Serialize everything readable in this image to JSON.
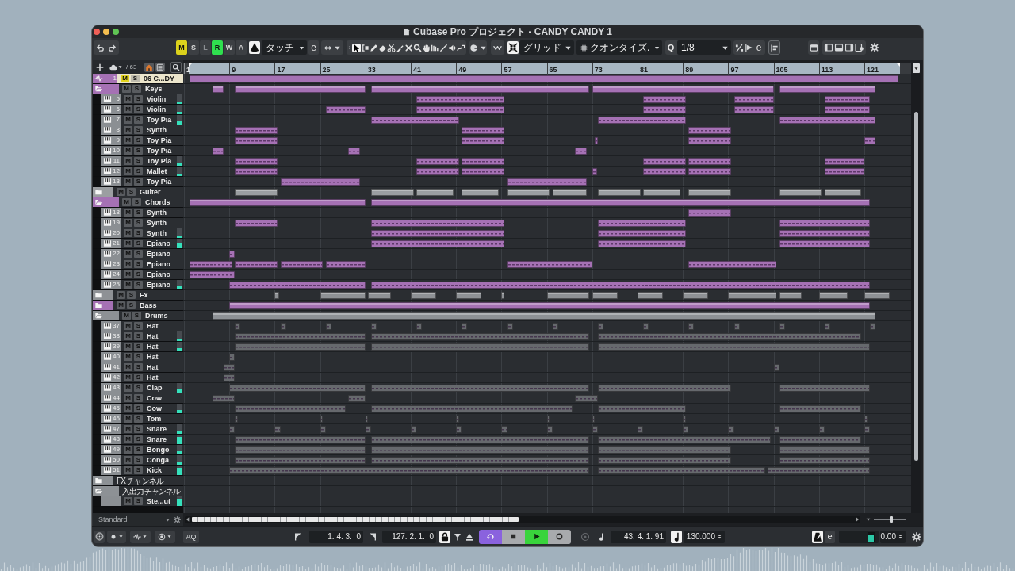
{
  "window": {
    "title": "Cubase Pro プロジェクト - CANDY CANDY 1"
  },
  "toolbar": {
    "indicators": [
      {
        "label": "M",
        "on": true,
        "disabled": false,
        "color": "#dcd21c"
      },
      {
        "label": "S",
        "on": false,
        "disabled": false
      },
      {
        "label": "L",
        "on": false,
        "disabled": true
      },
      {
        "label": "R",
        "on": true,
        "disabled": false,
        "color": "#2fe04f"
      },
      {
        "label": "W",
        "on": false,
        "disabled": false
      },
      {
        "label": "A",
        "on": false,
        "disabled": false
      }
    ],
    "automation_mode": {
      "value": "タッチ",
      "edit": "e"
    },
    "tools": [
      {
        "kind": "pointer",
        "selected": true
      },
      {
        "kind": "range",
        "selected": false
      },
      {
        "kind": "pencil",
        "selected": false
      },
      {
        "kind": "eraser",
        "selected": false
      },
      {
        "kind": "scissors",
        "selected": false
      },
      {
        "kind": "glue",
        "selected": false
      },
      {
        "kind": "cross",
        "selected": false
      },
      {
        "kind": "magnifier",
        "selected": false
      },
      {
        "kind": "hand",
        "selected": false
      },
      {
        "kind": "bars",
        "selected": false
      },
      {
        "kind": "line",
        "selected": false
      },
      {
        "kind": "speaker",
        "selected": false
      },
      {
        "kind": "warp",
        "selected": false
      }
    ],
    "snap": {
      "on": true,
      "value": "グリッド"
    },
    "grid_type": {
      "value": "クオンタイズ."
    },
    "quantize": {
      "label": "Q",
      "value": "1/8",
      "edit": "e"
    }
  },
  "track_list": {
    "count": "/ 63",
    "tracks": [
      {
        "kind": "audio",
        "number": "1",
        "name": "06 C...DY",
        "mute": "M",
        "solo": "S",
        "muted": true,
        "selected": true,
        "color": "#a571b4"
      },
      {
        "kind": "folder",
        "name": "Keys",
        "mute": "M",
        "solo": "S",
        "muted": false,
        "selected": false,
        "expanded": true,
        "color": "#a571b4",
        "children": [
          {
            "kind": "instrument",
            "number": "5",
            "name": "Violin",
            "mute": "M",
            "solo": "S",
            "muted": false,
            "selected": false,
            "color": "#a571b4",
            "level": 0.25
          },
          {
            "kind": "instrument",
            "number": "6",
            "name": "Violin",
            "mute": "M",
            "solo": "S",
            "muted": false,
            "selected": false,
            "color": "#a571b4",
            "level": 0.25
          },
          {
            "kind": "instrument",
            "number": "7",
            "name": "Toy Pia",
            "mute": "M",
            "solo": "S",
            "muted": false,
            "selected": false,
            "color": "#a571b4",
            "level": 0.33
          },
          {
            "kind": "instrument",
            "number": "8",
            "name": "Synth",
            "mute": "M",
            "solo": "S",
            "muted": false,
            "selected": false,
            "color": "#a571b4"
          },
          {
            "kind": "instrument",
            "number": "9",
            "name": "Toy Pia",
            "mute": "M",
            "solo": "S",
            "muted": false,
            "selected": false,
            "color": "#a571b4"
          },
          {
            "kind": "instrument",
            "number": "10",
            "name": "Toy Pia",
            "mute": "M",
            "solo": "S",
            "muted": false,
            "selected": false,
            "color": "#a571b4"
          },
          {
            "kind": "instrument",
            "number": "11",
            "name": "Toy Pia",
            "mute": "M",
            "solo": "S",
            "muted": false,
            "selected": false,
            "color": "#a571b4",
            "level": 0.25
          },
          {
            "kind": "instrument",
            "number": "12",
            "name": "Mallet",
            "mute": "M",
            "solo": "S",
            "muted": false,
            "selected": false,
            "color": "#a571b4",
            "level": 0.25
          },
          {
            "kind": "instrument",
            "number": "13",
            "name": "Toy Pia",
            "mute": "M",
            "solo": "S",
            "muted": false,
            "selected": false,
            "color": "#a571b4"
          }
        ]
      },
      {
        "kind": "folder",
        "name": "Guiter",
        "mute": "M",
        "solo": "S",
        "muted": false,
        "selected": false,
        "expanded": false,
        "color": "#9b9ea1"
      },
      {
        "kind": "folder",
        "name": "Chords",
        "mute": "M",
        "solo": "S",
        "muted": false,
        "selected": false,
        "expanded": true,
        "color": "#a571b4",
        "children": [
          {
            "kind": "instrument",
            "number": "18",
            "name": "Synth",
            "mute": "M",
            "solo": "S",
            "muted": false,
            "selected": false,
            "color": "#a571b4"
          },
          {
            "kind": "instrument",
            "number": "19",
            "name": "Synth",
            "mute": "M",
            "solo": "S",
            "muted": false,
            "selected": false,
            "color": "#a571b4"
          },
          {
            "kind": "instrument",
            "number": "20",
            "name": "Synth",
            "mute": "M",
            "solo": "S",
            "muted": false,
            "selected": false,
            "color": "#a571b4",
            "level": 0.25
          },
          {
            "kind": "instrument",
            "number": "21",
            "name": "Epiano",
            "mute": "M",
            "solo": "S",
            "muted": false,
            "selected": false,
            "color": "#a571b4",
            "level": 0.5
          },
          {
            "kind": "instrument",
            "number": "22",
            "name": "Epiano",
            "mute": "M",
            "solo": "S",
            "muted": false,
            "selected": false,
            "color": "#a571b4"
          },
          {
            "kind": "instrument",
            "number": "23",
            "name": "Epiano",
            "mute": "M",
            "solo": "S",
            "muted": false,
            "selected": false,
            "color": "#a571b4"
          },
          {
            "kind": "instrument",
            "number": "24",
            "name": "Epiano",
            "mute": "M",
            "solo": "S",
            "muted": false,
            "selected": false,
            "color": "#a571b4"
          },
          {
            "kind": "instrument",
            "number": "25",
            "name": "Epiano",
            "mute": "M",
            "solo": "S",
            "muted": false,
            "selected": false,
            "color": "#a571b4",
            "level": 0.33
          }
        ]
      },
      {
        "kind": "folder",
        "name": "Fx",
        "mute": "M",
        "solo": "S",
        "muted": false,
        "selected": false,
        "expanded": false,
        "color": "#8e9195"
      },
      {
        "kind": "folder",
        "name": "Bass",
        "mute": "M",
        "solo": "S",
        "muted": false,
        "selected": false,
        "expanded": false,
        "color": "#a571b4"
      },
      {
        "kind": "folder",
        "name": "Drums",
        "mute": "M",
        "solo": "S",
        "muted": false,
        "selected": false,
        "expanded": true,
        "color": "#8d9195",
        "children": [
          {
            "kind": "instrument",
            "number": "37",
            "name": "Hat",
            "mute": "M",
            "solo": "S",
            "muted": false,
            "selected": false,
            "color": "#66696d"
          },
          {
            "kind": "instrument",
            "number": "38",
            "name": "Hat",
            "mute": "M",
            "solo": "S",
            "muted": false,
            "selected": false,
            "color": "#66696d",
            "level": 0.25
          },
          {
            "kind": "instrument",
            "number": "39",
            "name": "Hat",
            "mute": "M",
            "solo": "S",
            "muted": false,
            "selected": false,
            "color": "#66696d",
            "level": 0.33
          },
          {
            "kind": "instrument",
            "number": "40",
            "name": "Hat",
            "mute": "M",
            "solo": "S",
            "muted": false,
            "selected": false,
            "color": "#66696d"
          },
          {
            "kind": "instrument",
            "number": "41",
            "name": "Hat",
            "mute": "M",
            "solo": "S",
            "muted": false,
            "selected": false,
            "color": "#66696d"
          },
          {
            "kind": "instrument",
            "number": "42",
            "name": "Hat",
            "mute": "M",
            "solo": "S",
            "muted": false,
            "selected": false,
            "color": "#66696d"
          },
          {
            "kind": "instrument",
            "number": "43",
            "name": "Clap",
            "mute": "M",
            "solo": "S",
            "muted": false,
            "selected": false,
            "color": "#66696d",
            "level": 0.33
          },
          {
            "kind": "instrument",
            "number": "44",
            "name": "Cow",
            "mute": "M",
            "solo": "S",
            "muted": false,
            "selected": false,
            "color": "#66696d"
          },
          {
            "kind": "instrument",
            "number": "45",
            "name": "Cow",
            "mute": "M",
            "solo": "S",
            "muted": false,
            "selected": false,
            "color": "#66696d",
            "level": 0.33
          },
          {
            "kind": "instrument",
            "number": "46",
            "name": "Tom",
            "mute": "M",
            "solo": "S",
            "muted": false,
            "selected": false,
            "color": "#66696d"
          },
          {
            "kind": "instrument",
            "number": "47",
            "name": "Snare",
            "mute": "M",
            "solo": "S",
            "muted": false,
            "selected": false,
            "color": "#66696d",
            "level": 0.25
          },
          {
            "kind": "instrument",
            "number": "48",
            "name": "Snare",
            "mute": "M",
            "solo": "S",
            "muted": false,
            "selected": false,
            "color": "#66696d",
            "level": 0.75
          },
          {
            "kind": "instrument",
            "number": "49",
            "name": "Bongo",
            "mute": "M",
            "solo": "S",
            "muted": false,
            "selected": false,
            "color": "#66696d",
            "level": 0.33
          },
          {
            "kind": "instrument",
            "number": "50",
            "name": "Conga",
            "mute": "M",
            "solo": "S",
            "muted": false,
            "selected": false,
            "color": "#66696d",
            "level": 0.25
          },
          {
            "kind": "instrument",
            "number": "51",
            "name": "Kick",
            "mute": "M",
            "solo": "S",
            "muted": false,
            "selected": false,
            "color": "#66696d",
            "level": 0.75
          }
        ]
      },
      {
        "kind": "folder",
        "name": "FX チャンネル",
        "selected": false,
        "expanded": false
      },
      {
        "kind": "folder",
        "name": "入出力チャンネル",
        "selected": false,
        "expanded": true,
        "children": [
          {
            "kind": "output",
            "name": "Ste...ut",
            "mute": "M",
            "solo": "S",
            "muted": false,
            "selected": false,
            "level": 0.75
          }
        ]
      }
    ]
  },
  "ruler": {
    "labels": [
      "1",
      "9",
      "17",
      "25",
      "33",
      "41",
      "49",
      "57",
      "65",
      "73",
      "81",
      "89",
      "97",
      "105",
      "113",
      "121"
    ]
  },
  "status_bar": {
    "preset": "Standard",
    "zoom": {
      "level": 0.55
    }
  },
  "transport": {
    "auto_quantize": "AQ",
    "left_locator": "1. 4. 3.  0",
    "right_locator": "127. 2. 1.  0",
    "buttons": [
      {
        "kind": "cycle",
        "on": true
      },
      {
        "kind": "stop",
        "on": false
      },
      {
        "kind": "play",
        "on": true
      },
      {
        "kind": "record",
        "on": false
      }
    ],
    "position": "43. 4. 1. 91",
    "tempo": "130.000",
    "click_edit": "e",
    "meter": {
      "level": 0.6
    },
    "volume": "0.00"
  }
}
